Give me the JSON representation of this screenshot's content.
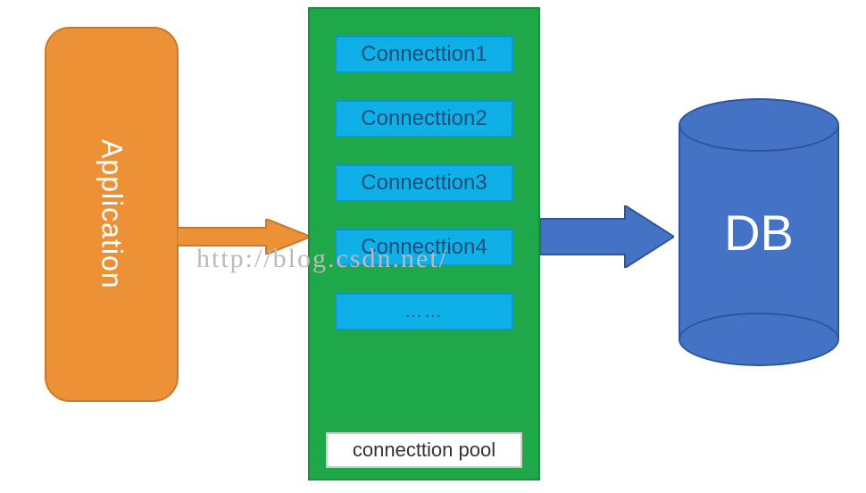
{
  "application": {
    "label": "Application"
  },
  "pool": {
    "items": [
      "Connecttion1",
      "Connecttion2",
      "Connecttion3",
      "Connecttion4",
      "……"
    ],
    "caption": "connecttion pool"
  },
  "db": {
    "label": "DB"
  },
  "watermark": "http://blog.csdn.net/",
  "colors": {
    "application": "#ED9136",
    "pool_bg": "#1EA84A",
    "connection": "#0FB0E8",
    "db": "#4472C4",
    "arrow1": "#ED9136",
    "arrow2": "#4472C4"
  }
}
